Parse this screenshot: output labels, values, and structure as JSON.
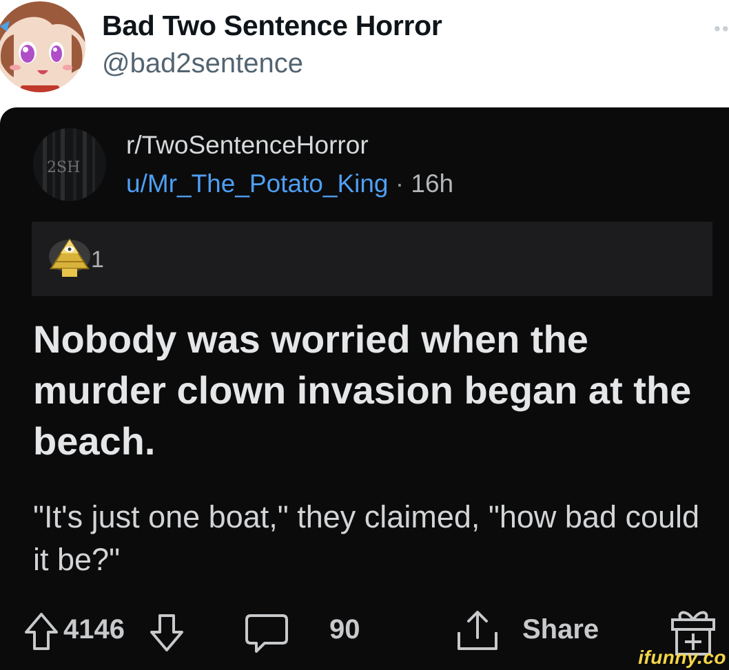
{
  "tweet": {
    "display_name": "Bad Two Sentence Horror",
    "handle": "@bad2sentence",
    "avatar_icon": "anime-avatar-icon",
    "more_icon": "more-options-icon"
  },
  "post": {
    "subreddit": "r/TwoSentenceHorror",
    "subreddit_icon_text": "2SH",
    "username": "u/Mr_The_Potato_King",
    "separator": "·",
    "age": "16h",
    "award_count": "1",
    "title": "Nobody was worried when the murder clown invasion began at the beach.",
    "body": "\"It's just one boat,\" they claimed, \"how bad could it be?\"",
    "actions": {
      "upvotes": "4146",
      "comments": "90",
      "share_label": "Share"
    }
  },
  "watermark": "ifunny.co",
  "colors": {
    "username_link": "#4f9ff3",
    "post_background": "#0b0b0c",
    "award_bar": "#1c1c1e",
    "watermark": "#f5d547"
  }
}
